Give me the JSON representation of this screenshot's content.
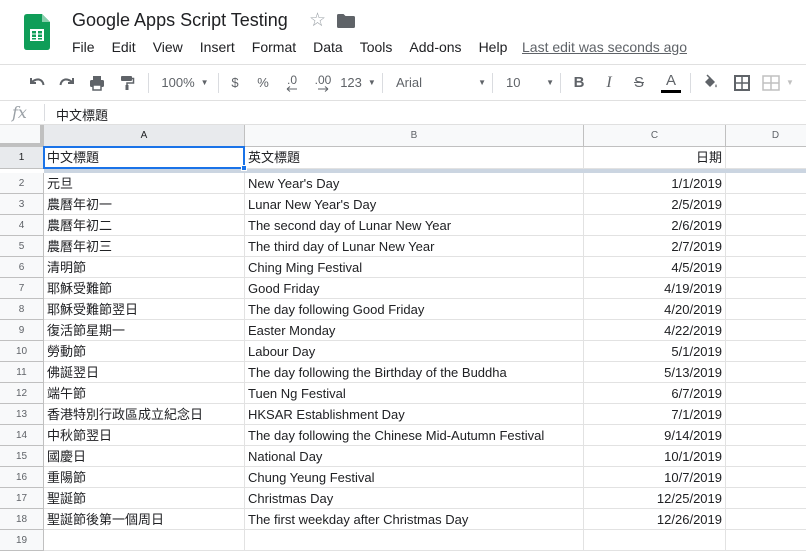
{
  "app": {
    "title": "Google Apps Script Testing",
    "last_edit": "Last edit was seconds ago",
    "menu": [
      "File",
      "Edit",
      "View",
      "Insert",
      "Format",
      "Data",
      "Tools",
      "Add-ons",
      "Help"
    ]
  },
  "toolbar": {
    "zoom": "100%",
    "currency": "$",
    "percent": "%",
    "decrease_decimal": ".0",
    "increase_decimal": ".00",
    "more_formats": "123",
    "font": "Arial",
    "font_size": "10",
    "bold": "B",
    "italic": "I",
    "strikethrough": "S",
    "text_color": "A",
    "text_color_value": "#000000"
  },
  "formula_bar": {
    "fx": "fx",
    "value": "中文標題"
  },
  "grid": {
    "columns": [
      "A",
      "B",
      "C",
      "D"
    ],
    "row_numbers": [
      "1",
      "2",
      "3",
      "4",
      "5",
      "6",
      "7",
      "8",
      "9",
      "10",
      "11",
      "12",
      "13",
      "14",
      "15",
      "16",
      "17",
      "18",
      "19"
    ],
    "header_row": [
      "中文標題",
      "英文標題",
      "日期"
    ],
    "rows": [
      [
        "元旦",
        "New Year's Day",
        "1/1/2019"
      ],
      [
        "農曆年初一",
        "Lunar New Year's Day",
        "2/5/2019"
      ],
      [
        "農曆年初二",
        "The second day of Lunar New Year",
        "2/6/2019"
      ],
      [
        "農曆年初三",
        "The third day of Lunar New Year",
        "2/7/2019"
      ],
      [
        "清明節",
        "Ching Ming Festival",
        "4/5/2019"
      ],
      [
        "耶穌受難節",
        "Good Friday",
        "4/19/2019"
      ],
      [
        "耶穌受難節翌日",
        "The day following Good Friday",
        "4/20/2019"
      ],
      [
        "復活節星期一",
        "Easter Monday",
        "4/22/2019"
      ],
      [
        "勞動節",
        "Labour Day",
        "5/1/2019"
      ],
      [
        "佛誕翌日",
        "The day following the Birthday of the Buddha",
        "5/13/2019"
      ],
      [
        "端午節",
        "Tuen Ng Festival",
        "6/7/2019"
      ],
      [
        "香港特別行政區成立紀念日",
        "HKSAR Establishment Day",
        "7/1/2019"
      ],
      [
        "中秋節翌日",
        "The day following the Chinese Mid-Autumn Festival",
        "9/14/2019"
      ],
      [
        "國慶日",
        "National Day",
        "10/1/2019"
      ],
      [
        "重陽節",
        "Chung Yeung Festival",
        "10/7/2019"
      ],
      [
        "聖誕節",
        "Christmas Day",
        "12/25/2019"
      ],
      [
        "聖誕節後第一個周日",
        "The first weekday after Christmas Day",
        "12/26/2019"
      ]
    ],
    "selected_cell": "A1"
  },
  "colors": {
    "brand_green": "#0f9d58",
    "selection_blue": "#1a73e8"
  }
}
